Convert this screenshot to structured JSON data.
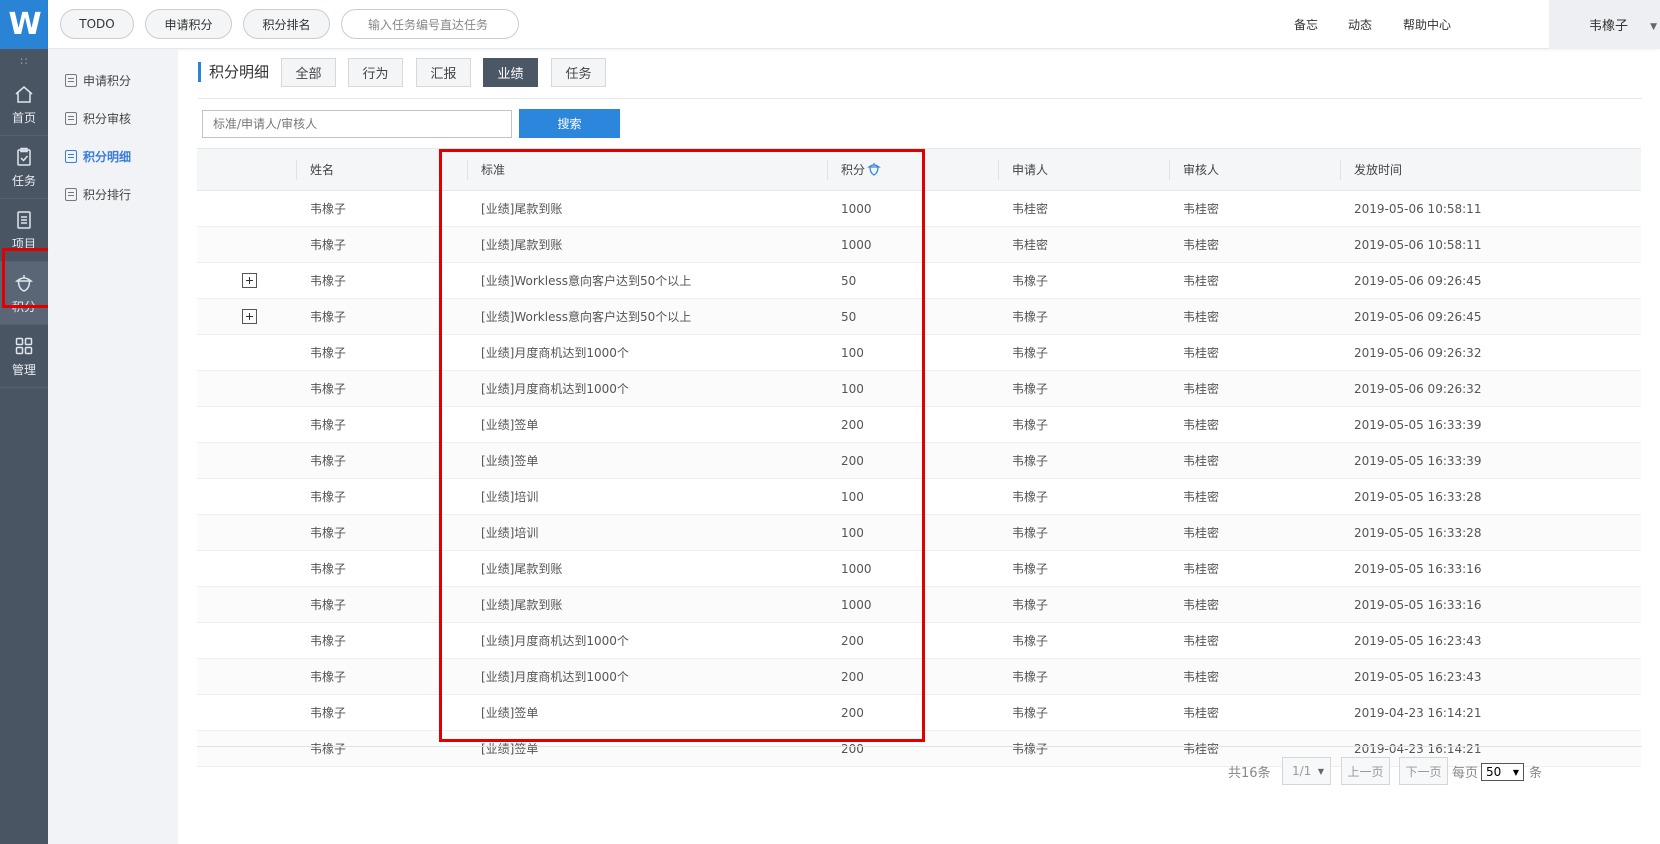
{
  "app": {
    "logo_text": "W"
  },
  "rail": {
    "grid_glyph": "∷",
    "items": [
      {
        "label": "首页",
        "icon": "home-icon"
      },
      {
        "label": "任务",
        "icon": "clipboard-check-icon"
      },
      {
        "label": "项目",
        "icon": "document-list-icon"
      },
      {
        "label": "积分",
        "icon": "acorn-icon",
        "active": true
      },
      {
        "label": "管理",
        "icon": "apps-grid-icon"
      }
    ]
  },
  "topbar": {
    "buttons": [
      "TODO",
      "申请积分",
      "积分排名"
    ],
    "search_placeholder": "输入任务编号直达任务",
    "links": [
      "备忘",
      "动态",
      "帮助中心"
    ],
    "user": "韦橡子",
    "user_caret": "▼"
  },
  "subnav": {
    "items": [
      {
        "label": "申请积分"
      },
      {
        "label": "积分审核"
      },
      {
        "label": "积分明细",
        "active": true
      },
      {
        "label": "积分排行"
      }
    ]
  },
  "main": {
    "title": "积分明细",
    "tabs": [
      "全部",
      "行为",
      "汇报",
      "业绩",
      "任务"
    ],
    "active_tab": "业绩",
    "search_placeholder": "标准/申请人/审核人",
    "search_button": "搜索",
    "columns": [
      "姓名",
      "标准",
      "积分",
      "申请人",
      "审核人",
      "发放时间"
    ],
    "rows": [
      {
        "expand": false,
        "name": "韦橡子",
        "standard": "[业绩]尾款到账",
        "points": "1000",
        "applicant": "韦桂密",
        "reviewer": "韦桂密",
        "time": "2019-05-06 10:58:11"
      },
      {
        "expand": false,
        "name": "韦橡子",
        "standard": "[业绩]尾款到账",
        "points": "1000",
        "applicant": "韦桂密",
        "reviewer": "韦桂密",
        "time": "2019-05-06 10:58:11"
      },
      {
        "expand": true,
        "name": "韦橡子",
        "standard": "[业绩]Workless意向客户达到50个以上",
        "points": "50",
        "applicant": "韦橡子",
        "reviewer": "韦桂密",
        "time": "2019-05-06 09:26:45"
      },
      {
        "expand": true,
        "name": "韦橡子",
        "standard": "[业绩]Workless意向客户达到50个以上",
        "points": "50",
        "applicant": "韦橡子",
        "reviewer": "韦桂密",
        "time": "2019-05-06 09:26:45"
      },
      {
        "expand": false,
        "name": "韦橡子",
        "standard": "[业绩]月度商机达到1000个",
        "points": "100",
        "applicant": "韦橡子",
        "reviewer": "韦桂密",
        "time": "2019-05-06 09:26:32"
      },
      {
        "expand": false,
        "name": "韦橡子",
        "standard": "[业绩]月度商机达到1000个",
        "points": "100",
        "applicant": "韦橡子",
        "reviewer": "韦桂密",
        "time": "2019-05-06 09:26:32"
      },
      {
        "expand": false,
        "name": "韦橡子",
        "standard": "[业绩]签单",
        "points": "200",
        "applicant": "韦橡子",
        "reviewer": "韦桂密",
        "time": "2019-05-05 16:33:39"
      },
      {
        "expand": false,
        "name": "韦橡子",
        "standard": "[业绩]签单",
        "points": "200",
        "applicant": "韦橡子",
        "reviewer": "韦桂密",
        "time": "2019-05-05 16:33:39"
      },
      {
        "expand": false,
        "name": "韦橡子",
        "standard": "[业绩]培训",
        "points": "100",
        "applicant": "韦橡子",
        "reviewer": "韦桂密",
        "time": "2019-05-05 16:33:28"
      },
      {
        "expand": false,
        "name": "韦橡子",
        "standard": "[业绩]培训",
        "points": "100",
        "applicant": "韦橡子",
        "reviewer": "韦桂密",
        "time": "2019-05-05 16:33:28"
      },
      {
        "expand": false,
        "name": "韦橡子",
        "standard": "[业绩]尾款到账",
        "points": "1000",
        "applicant": "韦橡子",
        "reviewer": "韦桂密",
        "time": "2019-05-05 16:33:16"
      },
      {
        "expand": false,
        "name": "韦橡子",
        "standard": "[业绩]尾款到账",
        "points": "1000",
        "applicant": "韦橡子",
        "reviewer": "韦桂密",
        "time": "2019-05-05 16:33:16"
      },
      {
        "expand": false,
        "name": "韦橡子",
        "standard": "[业绩]月度商机达到1000个",
        "points": "200",
        "applicant": "韦橡子",
        "reviewer": "韦桂密",
        "time": "2019-05-05 16:23:43"
      },
      {
        "expand": false,
        "name": "韦橡子",
        "standard": "[业绩]月度商机达到1000个",
        "points": "200",
        "applicant": "韦橡子",
        "reviewer": "韦桂密",
        "time": "2019-05-05 16:23:43"
      },
      {
        "expand": false,
        "name": "韦橡子",
        "standard": "[业绩]签单",
        "points": "200",
        "applicant": "韦橡子",
        "reviewer": "韦桂密",
        "time": "2019-04-23 16:14:21"
      },
      {
        "expand": false,
        "name": "韦橡子",
        "standard": "[业绩]签单",
        "points": "200",
        "applicant": "韦橡子",
        "reviewer": "韦桂密",
        "time": "2019-04-23 16:14:21"
      }
    ]
  },
  "pagination": {
    "total": "共16条",
    "page": "1/1",
    "page_caret": "▼",
    "prev": "上一页",
    "next": "下一页",
    "per_page_label": "每页",
    "per_page": "50",
    "per_page_caret": "▼",
    "unit": "条"
  },
  "colors": {
    "accent": "#2c86db",
    "rail": "#4a5564",
    "active_tab": "#4c5766",
    "highlight": "#e00000"
  }
}
